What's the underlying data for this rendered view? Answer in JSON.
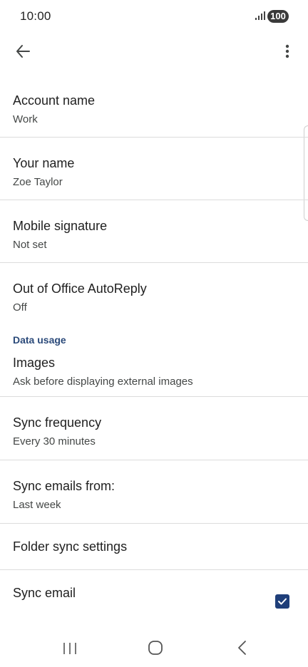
{
  "status_bar": {
    "time": "10:00",
    "battery": "100"
  },
  "top_bar": {
    "back_icon": "arrow-back-icon",
    "more_icon": "more-vert-icon"
  },
  "settings": {
    "account_name": {
      "title": "Account name",
      "value": "Work"
    },
    "your_name": {
      "title": "Your name",
      "value": "Zoe Taylor"
    },
    "mobile_signature": {
      "title": "Mobile signature",
      "value": "Not set"
    },
    "out_of_office": {
      "title": "Out of Office AutoReply",
      "value": "Off"
    },
    "data_usage_header": "Data usage",
    "images": {
      "title": "Images",
      "value": "Ask before displaying external images"
    },
    "sync_frequency": {
      "title": "Sync frequency",
      "value": "Every 30 minutes"
    },
    "sync_emails_from": {
      "title": "Sync emails from:",
      "value": "Last week"
    },
    "folder_sync": {
      "title": "Folder sync settings"
    },
    "sync_email": {
      "title": "Sync email",
      "checked": true
    }
  },
  "colors": {
    "accent": "#1f3f7a",
    "section_header": "#2b4a7a",
    "divider": "#dcdcdc"
  },
  "nav_bar": {
    "recents_icon": "recents-icon",
    "home_icon": "home-icon",
    "back_icon": "nav-back-icon"
  }
}
